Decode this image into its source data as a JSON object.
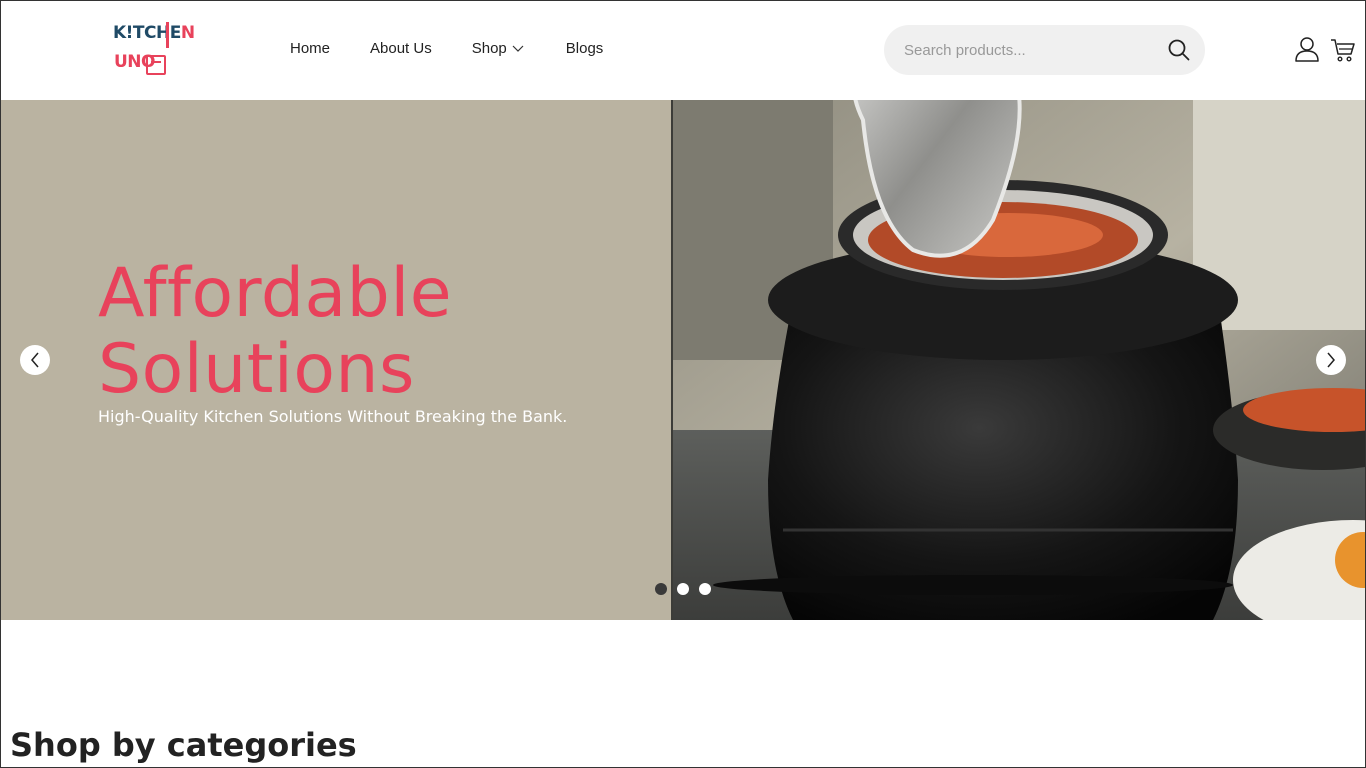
{
  "brand": {
    "logo_top": "K!TCHE",
    "logo_top_accent": "N",
    "logo_bottom": "UNO",
    "accent_color": "#e8425b",
    "dark_color": "#1f4a66"
  },
  "nav": {
    "items": [
      {
        "label": "Home"
      },
      {
        "label": "About Us"
      },
      {
        "label": "Shop"
      },
      {
        "label": "Blogs"
      }
    ]
  },
  "search": {
    "placeholder": "Search products...",
    "icon": "search-icon"
  },
  "header_icons": [
    "user-icon",
    "cart-icon"
  ],
  "hero": {
    "title_line1": "Affordable",
    "title_line2": "Solutions",
    "subtitle": "High-Quality Kitchen Solutions Without Breaking the Bank.",
    "background_color": "#bab3a1",
    "image_description": "black soup kettle warmer with open stainless lid",
    "slide_count": 3,
    "active_slide": 1
  },
  "sections": {
    "categories_title": "Shop by categories"
  }
}
